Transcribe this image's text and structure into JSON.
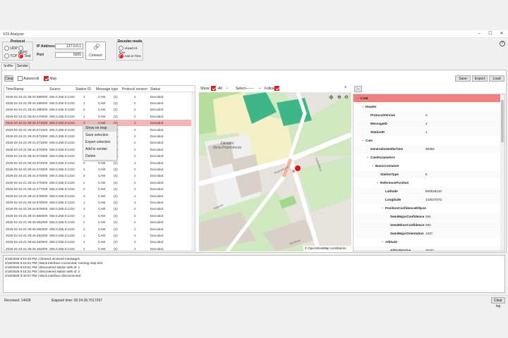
{
  "window": {
    "title": "V2X Analyzer"
  },
  "protocol": {
    "title": "Protocol",
    "udp": "UDP",
    "grpc": "gRPC",
    "tcp": "TCP",
    "test": "Test",
    "selected": "Test"
  },
  "connection": {
    "ip_label": "IP Address",
    "ip_value": "127.0.0.1",
    "port_label": "Port",
    "port_value": "5005",
    "connect_label": "Connect"
  },
  "decoder": {
    "title": "Decoder mode",
    "ahead": "Ahead-of-Time",
    "jit": "Just-in-Time",
    "selected": "Just-in-Time"
  },
  "tabs": [
    "Sniffer",
    "Sender"
  ],
  "sniffer": {
    "clear": "Clear",
    "autoscroll": "Autoscroll",
    "map": "Map",
    "save": "Save",
    "export": "Export",
    "load": "Load"
  },
  "grid": {
    "columns": [
      "TimeStamp",
      "Source",
      "Station ID",
      "Message type",
      "Protocol version",
      "Status"
    ],
    "rows": [
      [
        "2026-02-18 21:39:40.089000",
        "255.0.255.0:1234",
        "2",
        "CAM",
        "(2)",
        "2",
        "Decoded"
      ],
      [
        "2026-02-18 21:39:40.289000",
        "255.0.255.0:1234",
        "1",
        "CAM",
        "(2)",
        "2",
        "Decoded"
      ],
      [
        "2026-02-18 21:39:40.289000",
        "255.0.255.0:1234",
        "2",
        "CAM",
        "(2)",
        "2",
        "Decoded"
      ],
      [
        "2026-02-18 21:39:40.470000",
        "255.0.255.0:1234",
        "1",
        "CAM",
        "(2)",
        "2",
        "Decoded"
      ],
      [
        "2026-02-18 21:39:40.471000",
        "255.0.255.0:1234",
        "2",
        "CAM",
        "(2)",
        "2",
        "Decoded"
      ],
      [
        "2026-02-18 21:39:40.671000",
        "255.0.255.0:1234",
        "1",
        "CAM",
        "(2)",
        "2",
        "Decoded"
      ],
      [
        "2026-02-18 21:39:40.872000",
        "255.0.255.0:1234",
        "1",
        "CAM",
        "(2)",
        "2",
        "Decoded"
      ],
      [
        "2026-02-18 21:39:41.071000",
        "255.0.255.0:1234",
        "2",
        "CAM",
        "(2)",
        "2",
        "Decoded"
      ],
      [
        "2026-02-18 21:39:41.672000",
        "255.0.255.0:1234",
        "1",
        "CAM",
        "(2)",
        "2",
        "Decoded"
      ],
      [
        "2026-02-18 21:39:44.073000",
        "255.0.255.0:1234",
        "2",
        "CAM",
        "(2)",
        "2",
        "Decoded"
      ],
      [
        "2026-02-18 21:39:44.074000",
        "255.0.255.0:1234",
        "2",
        "CAM",
        "(2)",
        "2",
        "Decoded"
      ],
      [
        "2026-02-18 21:39:44.273000",
        "255.0.255.0:1234",
        "1",
        "CAM",
        "(2)",
        "2",
        "Decoded"
      ],
      [
        "2026-02-18 21:39:44.275000",
        "255.0.255.0:1234",
        "2",
        "CAM",
        "(2)",
        "2",
        "Decoded"
      ],
      [
        "2026-02-18 21:39:44.476000",
        "255.0.255.0:1234",
        "1",
        "CAM",
        "(2)",
        "2",
        "Decoded"
      ],
      [
        "2026-02-18 21:39:44.477000",
        "255.0.255.0:1234",
        "2",
        "CAM",
        "(2)",
        "2",
        "Decoded"
      ],
      [
        "2026-02-18 21:39:44.678000",
        "255.0.255.0:1234",
        "2",
        "CAM",
        "(2)",
        "2",
        "Decoded"
      ],
      [
        "2026-02-18 21:39:44.878000",
        "255.0.255.0:1234",
        "1",
        "CAM",
        "(2)",
        "2",
        "Decoded"
      ],
      [
        "2026-02-18 21:39:44.879000",
        "255.0.255.0:1234",
        "2",
        "CAM",
        "(2)",
        "2",
        "Decoded"
      ],
      [
        "2026-02-18 21:39:44.880000",
        "255.0.255.0:1234",
        "1",
        "CAM",
        "(2)",
        "2",
        "Decoded"
      ],
      [
        "2026-02-18 21:39:45.081000",
        "255.0.255.0:1234",
        "1",
        "CAM",
        "(2)",
        "2",
        "Decoded"
      ],
      [
        "2026-02-18 21:39:45.082000",
        "255.0.255.0:1234",
        "2",
        "CAM",
        "(2)",
        "2",
        "Decoded"
      ],
      [
        "2026-02-18 21:39:45.281000",
        "255.0.255.0:1234",
        "1",
        "CAM",
        "(2)",
        "2",
        "Decoded"
      ],
      [
        "2026-02-18 21:39:45.282000",
        "255.0.255.0:1234",
        "1",
        "CAM",
        "(2)",
        "2",
        "Decoded"
      ],
      [
        "2026-02-18 21:39:45.482000",
        "255.0.255.0:1234",
        "1",
        "CAM",
        "(2)",
        "2",
        "Decoded"
      ]
    ],
    "selected_row": 4
  },
  "context_menu": [
    "Show on map",
    "Save selection",
    "Export selection",
    "Add to sender",
    "Delete"
  ],
  "map": {
    "show_label": "Show",
    "show_value": "All",
    "select_label": "Select",
    "select_value": "-------",
    "follow_label": "Follow",
    "labels": {
      "school": "Základní\nškola Pramínková",
      "street1": "Pramínková",
      "street2": "Hájkova",
      "street3": "Bendova",
      "street4": "Kubelíkova"
    },
    "attribution": "© OpenStreetMap contributors"
  },
  "tree": {
    "collapse_btn": "−",
    "rows": [
      {
        "k": "CAM",
        "v": "",
        "lvl": 0,
        "ex": "⌄"
      },
      {
        "k": "Header",
        "v": "",
        "lvl": 1,
        "ex": "⌄"
      },
      {
        "k": "ProtocolVersion",
        "v": "2",
        "lvl": 2,
        "ex": ""
      },
      {
        "k": "MessageID",
        "v": "2",
        "lvl": 2,
        "ex": ""
      },
      {
        "k": "StationID",
        "v": "1",
        "lvl": 2,
        "ex": ""
      },
      {
        "k": "Cam",
        "v": "",
        "lvl": 1,
        "ex": "⌄"
      },
      {
        "k": "GenerationDeltaTime",
        "v": "39382",
        "lvl": 2,
        "ex": ""
      },
      {
        "k": "CamParameters",
        "v": "",
        "lvl": 2,
        "ex": "⌄"
      },
      {
        "k": "BasicContainer",
        "v": "",
        "lvl": 3,
        "ex": "⌄"
      },
      {
        "k": "StationType",
        "v": "5",
        "lvl": 4,
        "ex": ""
      },
      {
        "k": "ReferencePosition",
        "v": "",
        "lvl": 4,
        "ex": "⌄"
      },
      {
        "k": "Latitude",
        "v": "500528140",
        "lvl": 5,
        "ex": ""
      },
      {
        "k": "Longitude",
        "v": "144037070",
        "lvl": 5,
        "ex": ""
      },
      {
        "k": "PositionConfidenceEllipse",
        "v": "",
        "lvl": 5,
        "ex": "⌄"
      },
      {
        "k": "SemiMajorConfidence",
        "v": "284",
        "lvl": 6,
        "ex": ""
      },
      {
        "k": "SemiMinorConfidence",
        "v": "280",
        "lvl": 6,
        "ex": ""
      },
      {
        "k": "SemiMajorOrientation",
        "v": "1327",
        "lvl": 6,
        "ex": ""
      },
      {
        "k": "Altitude",
        "v": "",
        "lvl": 5,
        "ex": "⌄"
      },
      {
        "k": "AltitudeValue",
        "v": "25461",
        "lvl": 6,
        "ex": ""
      }
    ]
  },
  "log": [
    "2/18/2026 9:15:30 PM | Cleared received messages",
    "2/18/2026 9:15:31 PM | Mock interface connected, running map test",
    "2/18/2026 9:15:31 PM | Discovered station with id: 1",
    "2/18/2026 9:15:31 PM | Discovered station with id: 2",
    "2/18/2026 9:40:07 PM | Mock interface disconnected"
  ],
  "status": {
    "received": "Received: 14428",
    "elapsed": "Elapsed time: 00:24:36.7017267",
    "clear_log": "Clear log"
  },
  "colors": {
    "accent": "#e02020",
    "selected_row": "#f2b6b6",
    "tree_header": "#f08080"
  }
}
